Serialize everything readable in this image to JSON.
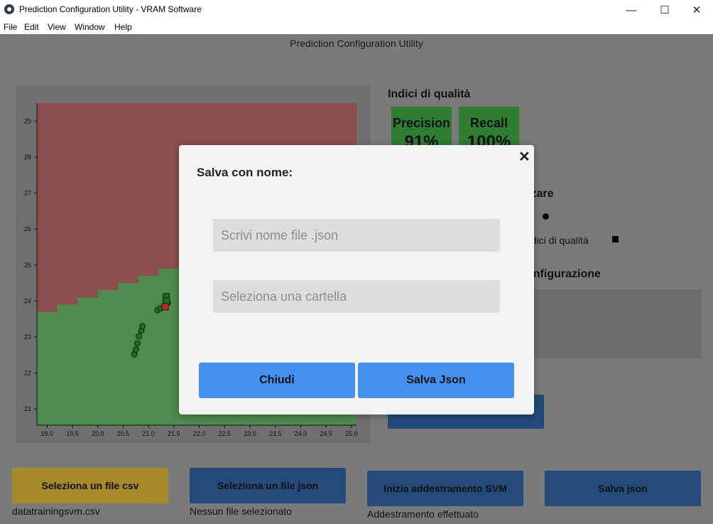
{
  "window": {
    "title": "Prediction Configuration Utility - VRAM Software",
    "controls": {
      "minimize": "—",
      "maximize": "☐",
      "close": "✕"
    }
  },
  "menu": [
    "File",
    "Edit",
    "View",
    "Window",
    "Help"
  ],
  "header": {
    "title": "Prediction Configuration Utility"
  },
  "plot": {
    "x_ticks": [
      "19.0",
      "19.5",
      "20.0",
      "20.5",
      "21.0",
      "21.5",
      "22.0",
      "22.5",
      "23.0",
      "23.5",
      "24.0",
      "24.5",
      "25.0"
    ],
    "y_ticks": [
      "21",
      "22",
      "23",
      "24",
      "25",
      "26",
      "27",
      "28",
      "29"
    ],
    "colors": {
      "red_region": "#8c4e4e",
      "green_region": "#4f8a4f",
      "points": "#1f6b1f",
      "misclassified": "#c62828"
    },
    "x_range": [
      18.8,
      25.1
    ],
    "y_range": [
      20.55,
      29.5
    ],
    "boundary_steps": [
      {
        "x": 18.8,
        "y": 23.7
      },
      {
        "x": 19.2,
        "y": 23.9
      },
      {
        "x": 19.6,
        "y": 24.1
      },
      {
        "x": 20.0,
        "y": 24.3
      },
      {
        "x": 20.4,
        "y": 24.5
      },
      {
        "x": 20.8,
        "y": 24.7
      },
      {
        "x": 21.2,
        "y": 24.9
      }
    ],
    "points": [
      {
        "x": 20.72,
        "y": 22.52
      },
      {
        "x": 20.75,
        "y": 22.65
      },
      {
        "x": 20.78,
        "y": 22.82
      },
      {
        "x": 20.81,
        "y": 23.02
      },
      {
        "x": 20.86,
        "y": 23.18
      },
      {
        "x": 20.88,
        "y": 23.3
      },
      {
        "x": 21.18,
        "y": 23.75
      },
      {
        "x": 21.24,
        "y": 23.8
      },
      {
        "x": 21.32,
        "y": 23.85
      },
      {
        "x": 21.38,
        "y": 23.95
      }
    ],
    "squares": [
      {
        "x": 21.35,
        "y": 24.12,
        "misclassified": false
      },
      {
        "x": 21.35,
        "y": 24.0,
        "misclassified": false
      },
      {
        "x": 21.33,
        "y": 23.84,
        "misclassified": true
      }
    ]
  },
  "quality": {
    "title": "Indici di qualità",
    "metrics": [
      {
        "label": "Precision",
        "value": "91%"
      },
      {
        "label": "Recall",
        "value": "100%"
      }
    ]
  },
  "side": {
    "visualize_title_fragment": "izzare",
    "legend_fragment": "ndici di qualità",
    "config_title_fragment": "onfigurazione"
  },
  "bottom": {
    "csv_button": "Seleziona un file csv",
    "csv_caption": "datatrainingsvm.csv",
    "json_button": "Seleziona un file json",
    "json_caption": "Nessun file selezionato",
    "train_button": "Inizia addestramento SVM",
    "train_caption": "Addestramento effettuato",
    "save_button": "Salva json",
    "colors": {
      "yellow": "#a68a2a",
      "blue": "#234a7a"
    }
  },
  "modal": {
    "title": "Salva con nome:",
    "close_symbol": "✕",
    "filename_placeholder": "Scrivi nome file .json",
    "folder_placeholder": "Seleziona una cartella",
    "close_button": "Chiudi",
    "save_button": "Salva Json",
    "accent": "#4390ee"
  }
}
